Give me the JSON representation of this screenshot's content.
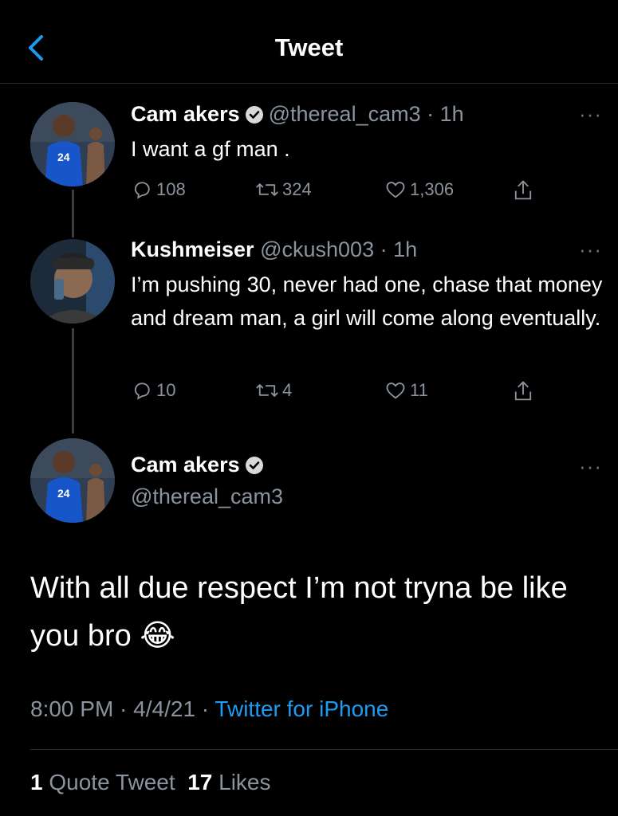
{
  "header": {
    "title": "Tweet"
  },
  "thread": [
    {
      "name": "Cam akers",
      "handle": "@thereal_cam3",
      "time": "1h",
      "text": "I want a gf man .",
      "replies": "108",
      "retweets": "324",
      "likes": "1,306"
    },
    {
      "name": "Kushmeiser",
      "handle": "@ckush003",
      "time": "1h",
      "text": "I’m pushing 30, never had one, chase that money and dream man, a girl will come along eventually.",
      "replies": "10",
      "retweets": "4",
      "likes": "11"
    }
  ],
  "main_tweet": {
    "name": "Cam akers",
    "handle": "@thereal_cam3",
    "text": "With all due respect I’m not tryna be like you bro",
    "emoji": "😂",
    "time": "8:00 PM",
    "date": "4/4/21",
    "source": "Twitter for iPhone",
    "quote_count": "1",
    "quote_label": "Quote Tweet",
    "likes_count": "17",
    "likes_label": "Likes"
  },
  "colors": {
    "background": "#000000",
    "accent": "#1d9bf0",
    "secondary_text": "#8b949e"
  },
  "icons": [
    "back-chevron-icon",
    "verified-badge-icon",
    "more-icon",
    "reply-icon",
    "retweet-icon",
    "like-icon",
    "share-icon"
  ]
}
